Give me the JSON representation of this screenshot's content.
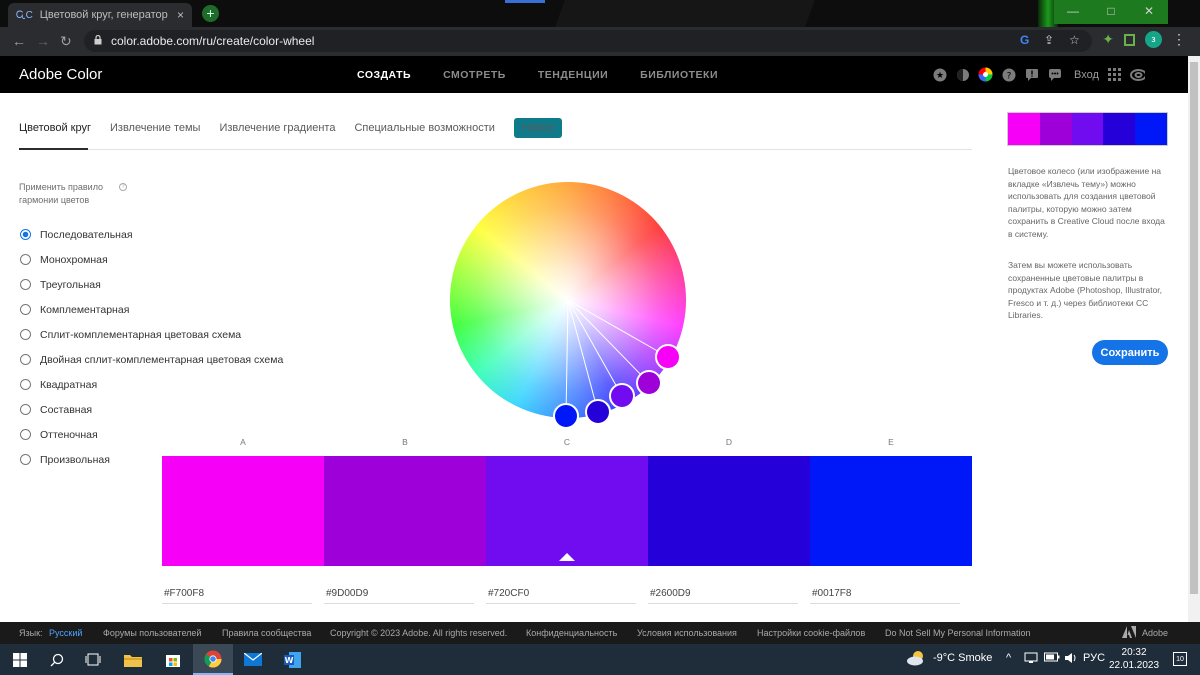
{
  "browser": {
    "tab_title": "Цветовой круг, генератор цвет",
    "url": "color.adobe.com/ru/create/color-wheel",
    "profile_letter": "з",
    "tab_close": "×",
    "newtab_plus": "+",
    "win_min": "—",
    "win_max": "□",
    "win_close": "✕"
  },
  "app": {
    "brand": "Adobe Color",
    "nav": [
      "СОЗДАТЬ",
      "СМОТРЕТЬ",
      "ТЕНДЕНЦИИ",
      "БИБЛИОТЕКИ"
    ],
    "login": "Вход"
  },
  "mode_tabs": [
    "Цветовой круг",
    "Извлечение темы",
    "Извлечение градиента",
    "Специальные возможности"
  ],
  "badge_new": "Новое",
  "harmony": {
    "label": "Применить правило гармонии цветов",
    "help": "?",
    "rules": [
      "Последовательная",
      "Монохромная",
      "Треугольная",
      "Комплементарная",
      "Сплит-комплементарная цветовая схема",
      "Двойная сплит-комплементарная цветовая схема",
      "Квадратная",
      "Составная",
      "Оттеночная",
      "Произвольная"
    ],
    "selected_index": 0
  },
  "swatch_letters": [
    "A",
    "B",
    "C",
    "D",
    "E"
  ],
  "swatches": [
    {
      "hex": "#F700F8",
      "color": "#F700F8"
    },
    {
      "hex": "#9D00D9",
      "color": "#9D00D9"
    },
    {
      "hex": "#720CF0",
      "color": "#720CF0"
    },
    {
      "hex": "#2600D9",
      "color": "#2600D9"
    },
    {
      "hex": "#0017F8",
      "color": "#0017F8"
    }
  ],
  "selected_swatch": 2,
  "sidebar": {
    "info1": "Цветовое колесо (или изображение на вкладке «Извлечь тему») можно использовать для создания цветовой палитры, которую можно затем сохранить в Creative Cloud после входа в систему.",
    "info2": "Затем вы можете использовать сохраненные цветовые палитры в продуктах Adobe (Photoshop, Illustrator, Fresco и т. д.) через библиотеки CC Libraries.",
    "save_button": "Сохранить"
  },
  "footer": {
    "lang_label": "Язык:",
    "lang_value": "Русский",
    "links": [
      "Форумы пользователей",
      "Правила сообщества",
      "Copyright © 2023 Adobe. All rights reserved.",
      "Конфиденциальность",
      "Условия использования",
      "Настройки cookie-файлов",
      "Do Not Sell My Personal Information"
    ],
    "adobe": "Adobe"
  },
  "taskbar": {
    "weather": "-9°C  Smoke",
    "lang": "РУС",
    "time": "20:32",
    "date": "22.01.2023",
    "notifications": "10"
  }
}
